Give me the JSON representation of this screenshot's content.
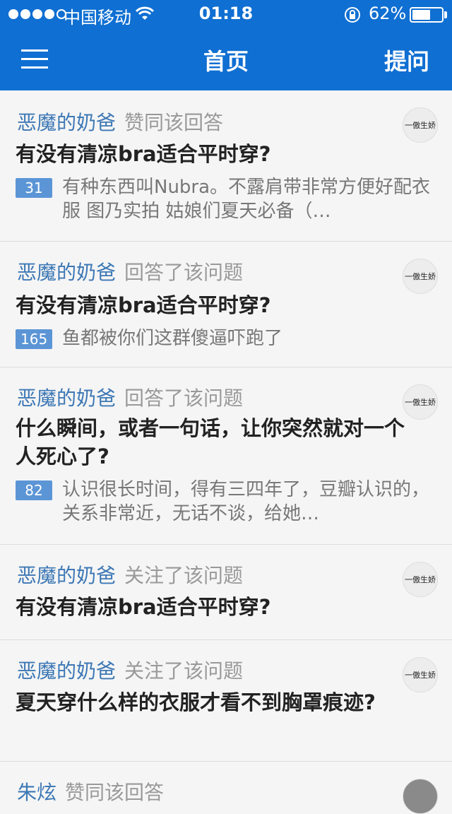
{
  "status_bar": {
    "carrier": "中国移动",
    "time": "01:18",
    "battery": "62%",
    "battery_level": 0.62
  },
  "nav": {
    "title": "首页",
    "ask_label": "提问"
  },
  "feed": [
    {
      "user": "恶魔的奶爸",
      "action": "赞同该回答",
      "question": "有没有清凉bra适合平时穿?",
      "votes": "31",
      "excerpt": "有种东西叫Nubra。不露肩带非常方便好配衣服 图乃实拍 姑娘们夏天必备（…",
      "avatar_text": "一傲生娇"
    },
    {
      "user": "恶魔的奶爸",
      "action": "回答了该问题",
      "question": "有没有清凉bra适合平时穿?",
      "votes": "165",
      "excerpt": "鱼都被你们这群傻逼吓跑了",
      "avatar_text": "一傲生娇"
    },
    {
      "user": "恶魔的奶爸",
      "action": "回答了该问题",
      "question": "什么瞬间，或者一句话，让你突然就对一个人死心了?",
      "votes": "82",
      "excerpt": "认识很长时间，得有三四年了，豆瓣认识的，关系非常近，无话不谈，给她…",
      "avatar_text": "一傲生娇"
    },
    {
      "user": "恶魔的奶爸",
      "action": "关注了该问题",
      "question": "有没有清凉bra适合平时穿?",
      "avatar_text": "一傲生娇"
    },
    {
      "user": "恶魔的奶爸",
      "action": "关注了该问题",
      "question": "夏天穿什么样的衣服才看不到胸罩痕迹?",
      "avatar_text": "一傲生娇"
    },
    {
      "user": "朱炫",
      "action": "赞同该回答"
    }
  ]
}
